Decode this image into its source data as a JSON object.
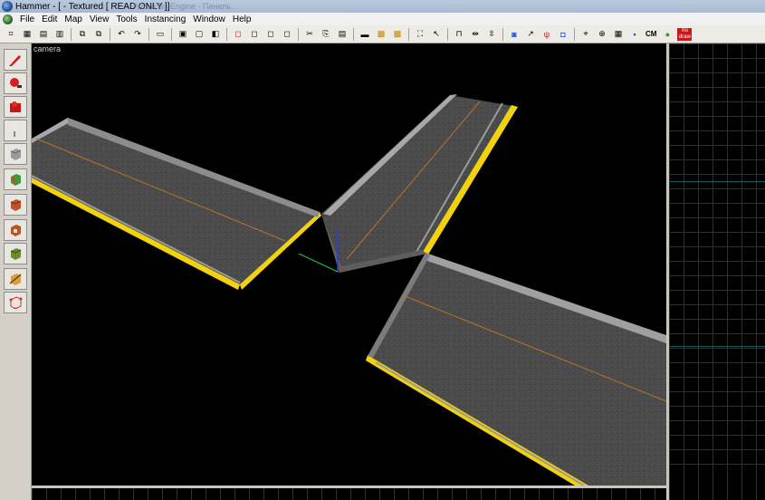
{
  "window": {
    "title": "Hammer - [ - Textured [ READ ONLY ]]",
    "ghost_tabs": "Valve Bo Engine - Панель..."
  },
  "menu": {
    "items": [
      "File",
      "Edit",
      "Map",
      "View",
      "Tools",
      "Instancing",
      "Window",
      "Help"
    ]
  },
  "toolbar": {
    "cm_label": "CM",
    "nodraw_label": "no draw",
    "icons": [
      "grid-icon",
      "grid-size-icon",
      "undo-icon",
      "redo-icon",
      "cut-icon",
      "copy-icon",
      "paste-icon",
      "select-icon",
      "texture-lock-icon",
      "carve-icon",
      "group-icon"
    ]
  },
  "tools": [
    {
      "name": "selection-tool",
      "color": "#cc1b1b"
    },
    {
      "name": "magnify-tool",
      "color": "#d42020"
    },
    {
      "name": "camera-tool",
      "color": "#c41818"
    },
    {
      "name": "entity-tool",
      "color": "#bdbdbd"
    },
    {
      "name": "block-tool",
      "color": "#9a9a9a"
    },
    {
      "name": "texture-application-tool",
      "color": "#3a9c3a"
    },
    {
      "name": "apply-current-texture-tool",
      "color": "#b8542a"
    },
    {
      "name": "decal-tool",
      "color": "#b8542a"
    },
    {
      "name": "overlay-tool",
      "color": "#6b8a2e"
    },
    {
      "name": "clipping-tool",
      "color": "#d8a040"
    },
    {
      "name": "vertex-tool",
      "color": "#cc3030"
    }
  ],
  "viewport": {
    "label": "camera",
    "asphalt_color": "#4a4a4a",
    "curb_color": "#f2d20a",
    "centerline_color": "#b8742a"
  }
}
